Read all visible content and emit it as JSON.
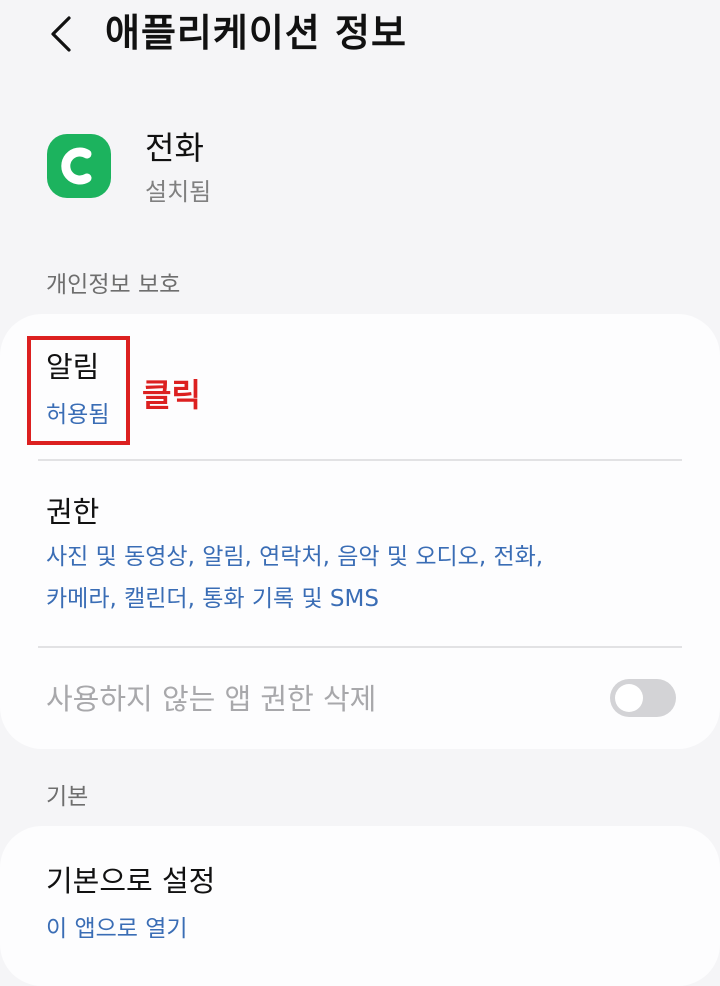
{
  "header": {
    "title": "애플리케이션 정보",
    "back_icon": "chevron-left-icon"
  },
  "app": {
    "name": "전화",
    "status": "설치됨",
    "icon": "phone-icon",
    "icon_color": "#1cb35e"
  },
  "sections": {
    "privacy": {
      "label": "개인정보 보호",
      "notifications": {
        "title": "알림",
        "value": "허용됨"
      },
      "permissions": {
        "title": "권한",
        "value_line1": "사진 및 동영상, 알림, 연락처, 음악 및 오디오, 전화,",
        "value_line2": "카메라, 캘린더, 통화 기록 및 SMS"
      },
      "remove_unused": {
        "title": "사용하지 않는 앱 권한 삭제",
        "enabled": false
      }
    },
    "default": {
      "label": "기본",
      "set_default": {
        "title": "기본으로 설정",
        "value": "이 앱으로 열기"
      }
    }
  },
  "annotation": {
    "click_label": "클릭",
    "color": "#dc2020"
  },
  "colors": {
    "link": "#3a6db5",
    "background": "#f5f5f7",
    "card": "#fdfdfe"
  }
}
